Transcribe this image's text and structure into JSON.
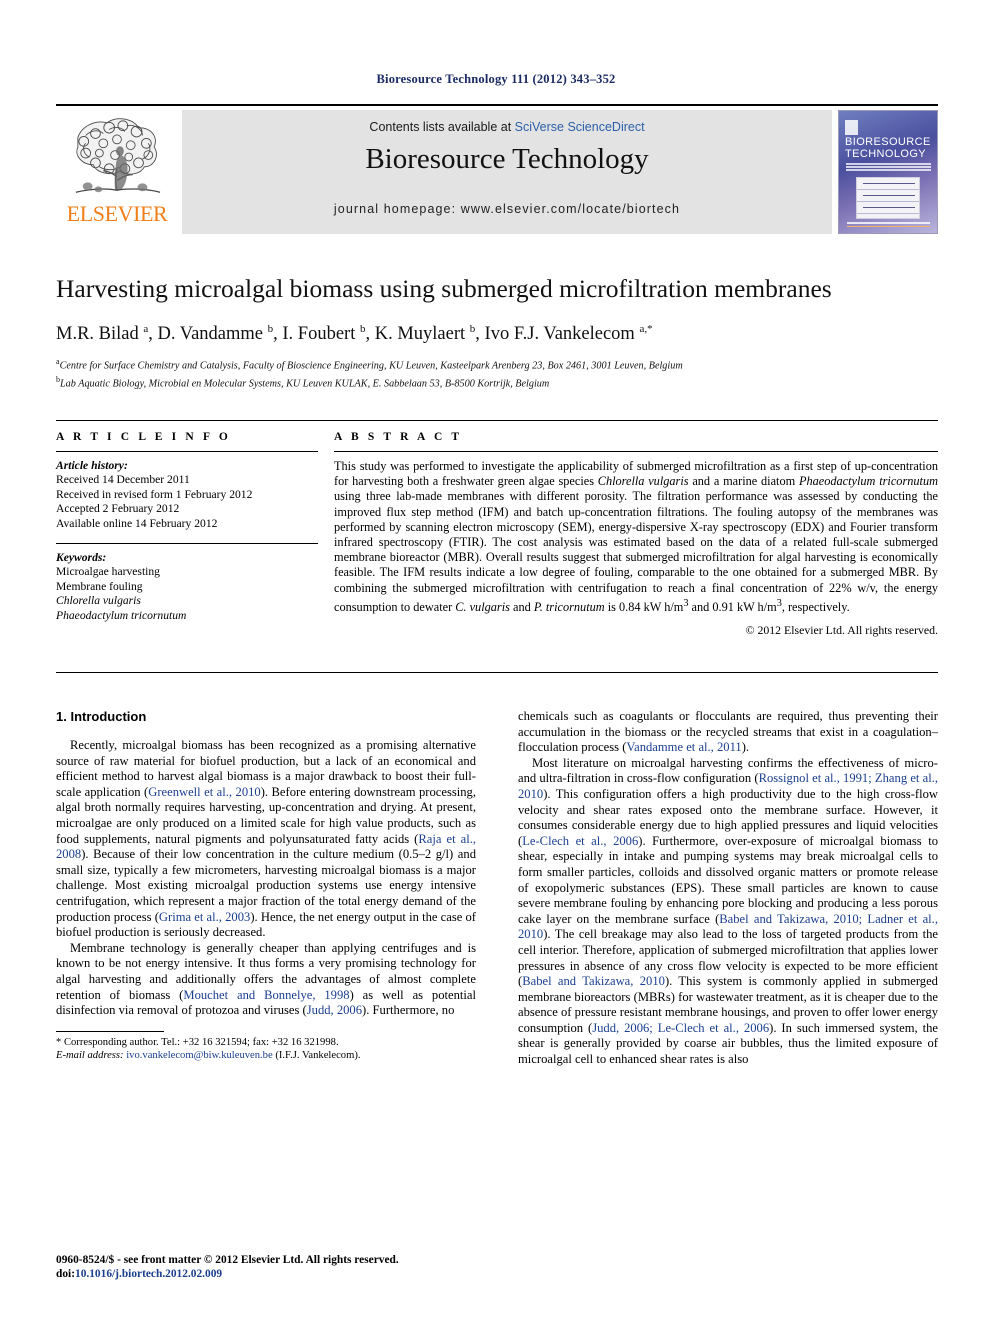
{
  "running_head": "Bioresource Technology 111 (2012) 343–352",
  "masthead": {
    "publisher": "ELSEVIER",
    "contents_prefix": "Contents lists available at ",
    "contents_link": "SciVerse ScienceDirect",
    "journal_title": "Bioresource Technology",
    "homepage": "journal homepage: www.elsevier.com/locate/biortech",
    "cover": {
      "title_line1": "BIORESOURCE",
      "title_line2": "TECHNOLOGY"
    }
  },
  "article": {
    "title": "Harvesting microalgal biomass using submerged microfiltration membranes",
    "authors_html": "M.R. Bilad <sup>a</sup>, D. Vandamme <sup>b</sup>, I. Foubert <sup>b</sup>, K. Muylaert <sup>b</sup>, Ivo F.J. Vankelecom <sup>a,*</sup>",
    "affiliation_a": "Centre for Surface Chemistry and Catalysis, Faculty of Bioscience Engineering, KU Leuven, Kasteelpark Arenberg 23, Box 2461, 3001 Leuven, Belgium",
    "affiliation_b": "Lab Aquatic Biology, Microbial en Molecular Systems, KU Leuven KULAK, E. Sabbelaan 53, B-8500 Kortrijk, Belgium"
  },
  "article_info": {
    "heading": "A R T I C L E    I N F O",
    "history_label": "Article history:",
    "history": [
      "Received 14 December 2011",
      "Received in revised form 1 February 2012",
      "Accepted 2 February 2012",
      "Available online 14 February 2012"
    ],
    "keywords_label": "Keywords:",
    "keywords": [
      "Microalgae harvesting",
      "Membrane fouling",
      "Chlorella vulgaris",
      "Phaeodactylum tricornutum"
    ]
  },
  "abstract": {
    "heading": "A B S T R A C T",
    "text_html": "This study was performed to investigate the applicability of submerged microfiltration as a first step of up-concentration for harvesting both a freshwater green algae species <i>Chlorella vulgaris</i> and a marine diatom <i>Phaeodactylum tricornutum</i> using three lab-made membranes with different porosity. The filtration performance was assessed by conducting the improved flux step method (IFM) and batch up-concentration filtrations. The fouling autopsy of the membranes was performed by scanning electron microscopy (SEM), energy-dispersive X-ray spectroscopy (EDX) and Fourier transform infrared spectroscopy (FTIR). The cost analysis was estimated based on the data of a related full-scale submerged membrane bioreactor (MBR). Overall results suggest that submerged microfiltration for algal harvesting is economically feasible. The IFM results indicate a low degree of fouling, comparable to the one obtained for a submerged MBR. By combining the submerged microfiltration with centrifugation to reach a final concentration of 22% w/v, the energy consumption to dewater <i>C. vulgaris</i> and <i>P. tricornutum</i> is 0.84 kW h/m<sup>3</sup> and 0.91 kW h/m<sup>3</sup>, respectively.",
    "copyright": "© 2012 Elsevier Ltd. All rights reserved."
  },
  "body": {
    "section1_heading": "1. Introduction",
    "left_para1_html": "Recently, microalgal biomass has been recognized as a promising alternative source of raw material for biofuel production, but a lack of an economical and efficient method to harvest algal biomass is a major drawback to boost their full-scale application (<span class=\"cite\">Greenwell et al., 2010</span>). Before entering downstream processing, algal broth normally requires harvesting, up-concentration and drying. At present, microalgae are only produced on a limited scale for high value products, such as food supplements, natural pigments and polyunsaturated fatty acids (<span class=\"cite\">Raja et al., 2008</span>). Because of their low concentration in the culture medium (0.5–2 g/l) and small size, typically a few micrometers, harvesting microalgal biomass is a major challenge. Most existing microalgal production systems use energy intensive centrifugation, which represent a major fraction of the total energy demand of the production process (<span class=\"cite\">Grima et al., 2003</span>). Hence, the net energy output in the case of biofuel production is seriously decreased.",
    "left_para2_html": "Membrane technology is generally cheaper than applying centrifuges and is known to be not energy intensive. It thus forms a very promising technology for algal harvesting and additionally offers the advantages of almost complete retention of biomass (<span class=\"cite\">Mouchet and Bonnelye, 1998</span>) as well as potential disinfection via removal of protozoa and viruses (<span class=\"cite\">Judd, 2006</span>). Furthermore, no",
    "right_para1_html": "chemicals such as coagulants or flocculants are required, thus preventing their accumulation in the biomass or the recycled streams that exist in a coagulation–flocculation process (<span class=\"cite\">Vandamme et al., 2011</span>).",
    "right_para2_html": "Most literature on microalgal harvesting confirms the effectiveness of micro- and ultra-filtration in cross-flow configuration (<span class=\"cite\">Rossignol et al., 1991; Zhang et al., 2010</span>). This configuration offers a high productivity due to the high cross-flow velocity and shear rates exposed onto the membrane surface. However, it consumes considerable energy due to high applied pressures and liquid velocities (<span class=\"cite\">Le-Clech et al., 2006</span>). Furthermore, over-exposure of microalgal biomass to shear, especially in intake and pumping systems may break microalgal cells to form smaller particles, colloids and dissolved organic matters or promote release of exopolymeric substances (EPS). These small particles are known to cause severe membrane fouling by enhancing pore blocking and producing a less porous cake layer on the membrane surface (<span class=\"cite\">Babel and Takizawa, 2010; Ladner et al., 2010</span>). The cell breakage may also lead to the loss of targeted products from the cell interior. Therefore, application of submerged microfiltration that applies lower pressures in absence of any cross flow velocity is expected to be more efficient (<span class=\"cite\">Babel and Takizawa, 2010</span>). This system is commonly applied in submerged membrane bioreactors (MBRs) for wastewater treatment, as it is cheaper due to the absence of pressure resistant membrane housings, and proven to offer lower energy consumption (<span class=\"cite\">Judd, 2006; Le-Clech et al., 2006</span>). In such immersed system, the shear is generally provided by coarse air bubbles, thus the limited exposure of microalgal cell to enhanced shear rates is also"
  },
  "footnote": {
    "corresponding_html": "* Corresponding author. Tel.: +32 16 321594; fax: +32 16 321998.",
    "email_html": "<span class=\"em\">E-mail address:</span> <a class=\"lnk\" href=\"#\">ivo.vankelecom@biw.kuleuven.be</a> (I.F.J. Vankelecom)."
  },
  "imprint": {
    "issn_line": "0960-8524/$ - see front matter © 2012 Elsevier Ltd. All rights reserved.",
    "doi_label": "doi:",
    "doi_value": "10.1016/j.biortech.2012.02.009"
  },
  "colors": {
    "link_blue": "#2b5fa8",
    "citation_blue": "#1b3f8f",
    "elsevier_orange": "#f07f1a",
    "running_head_navy": "#1b2a63",
    "banner_gray": "#e3e3e3"
  }
}
